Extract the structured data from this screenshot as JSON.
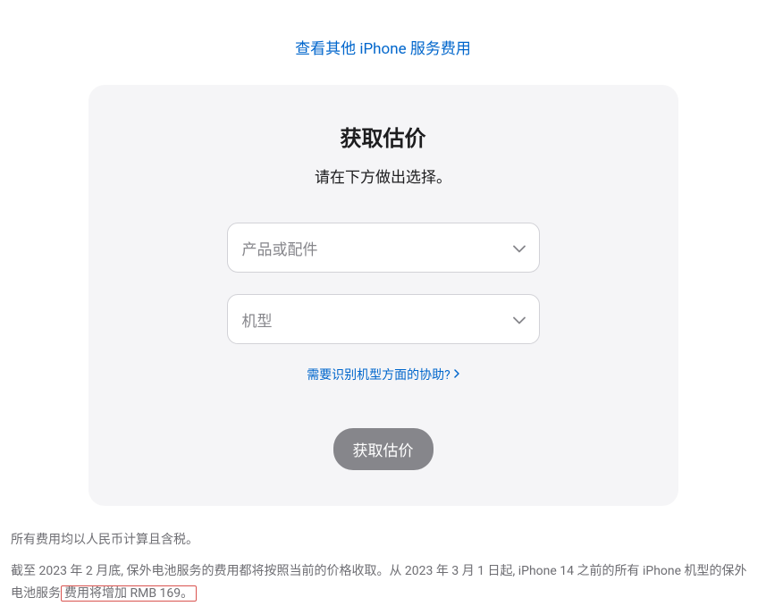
{
  "topLink": {
    "label": "查看其他 iPhone 服务费用"
  },
  "card": {
    "title": "获取估价",
    "subtitle": "请在下方做出选择。",
    "select1": {
      "placeholder": "产品或配件"
    },
    "select2": {
      "placeholder": "机型"
    },
    "helpLink": {
      "label": "需要识别机型方面的协助?"
    },
    "submit": {
      "label": "获取估价"
    }
  },
  "footer": {
    "line1": "所有费用均以人民币计算且含税。",
    "line2_prefix": "截至 2023 年 2 月底, 保外电池服务的费用都将按照当前的价格收取。从 2023 年 3 月 1 日起, iPhone 14 之前的所有 iPhone 机型的保外电池服务",
    "line2_highlight": "费用将增加 RMB 169。"
  }
}
